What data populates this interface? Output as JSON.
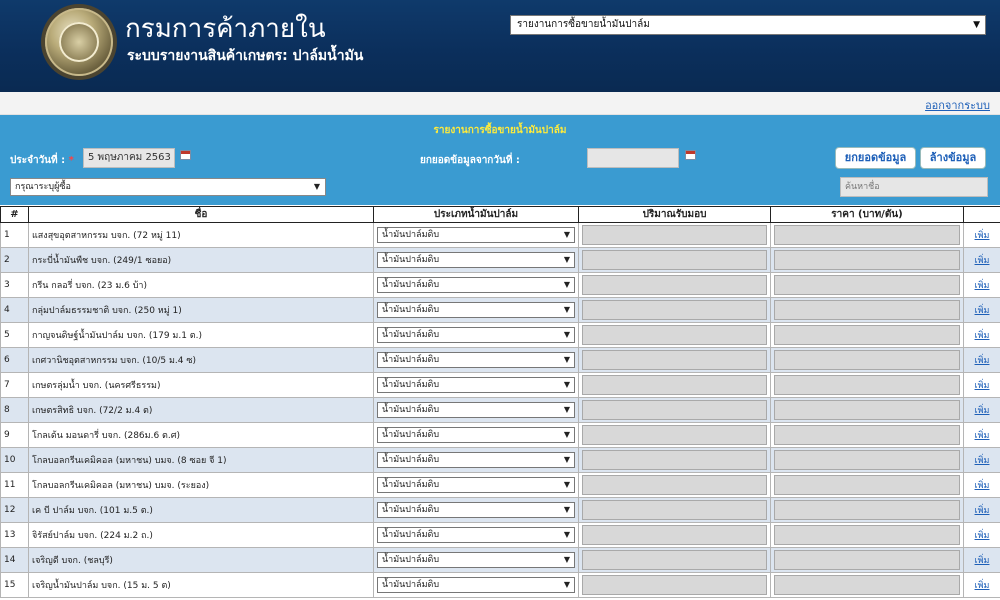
{
  "header": {
    "title": "กรมการค้าภายใน",
    "subtitle": "ระบบรายงานสินค้าเกษตร: ปาล์มน้ำมัน",
    "report_select": "รายงานการซื้อขายน้ำมันปาล์ม",
    "dropdown_icon": "triangle-down-icon"
  },
  "topbar": {
    "logout": "ออกจากระบบ"
  },
  "form": {
    "section_title": "รายงานการซื้อขายน้ำมันปาล์ม",
    "date_label": "ประจำวันที่ :",
    "required_mark": "*",
    "date_value": "5 พฤษภาคม 2563",
    "carry_label": "ยกยอดข้อมูลจากวันที่ :",
    "carry_value": "",
    "carry_button": "ยกยอดข้อมูล",
    "clear_button": "ล้างข้อมูล",
    "buyer_select": "กรุณาระบุผู้ซื้อ",
    "search_placeholder": "ค้นหาชื่อ"
  },
  "table": {
    "headers": [
      "#",
      "ชื่อ",
      "ประเภทน้ำมันปาล์ม",
      "ปริมาณรับมอบ",
      "ราคา (บาท/ตัน)",
      ""
    ],
    "rows": [
      {
        "no": "1",
        "name": "แสงสุขอุตสาหกรรม บจก. (72 หมู่ 11)",
        "type": "น้ำมันปาล์มดิบ",
        "action": "เพิ่ม"
      },
      {
        "no": "2",
        "name": "กระบี่น้ำมันพืช บจก. (249/1 ซอยอ)",
        "type": "น้ำมันปาล์มดิบ",
        "action": "เพิ่ม"
      },
      {
        "no": "3",
        "name": "กรีน กลอรี่ บจก. (23 ม.6 บ้า)",
        "type": "น้ำมันปาล์มดิบ",
        "action": "เพิ่ม"
      },
      {
        "no": "4",
        "name": "กลุ่มปาล์มธรรมชาติ บจก. (250 หมู่ 1)",
        "type": "น้ำมันปาล์มดิบ",
        "action": "เพิ่ม"
      },
      {
        "no": "5",
        "name": "กาญจนดิษฐ์น้ำมันปาล์ม บจก. (179 ม.1 ต.)",
        "type": "น้ำมันปาล์มดิบ",
        "action": "เพิ่ม"
      },
      {
        "no": "6",
        "name": "เกศวานิชอุตสาหกรรม บจก. (10/5 ม.4 ซ)",
        "type": "น้ำมันปาล์มดิบ",
        "action": "เพิ่ม"
      },
      {
        "no": "7",
        "name": "เกษตรลุ่มน้ำ บจก. (นครศรีธรรม)",
        "type": "น้ำมันปาล์มดิบ",
        "action": "เพิ่ม"
      },
      {
        "no": "8",
        "name": "เกษตรสิทธิ บจก. (72/2 ม.4 ต)",
        "type": "น้ำมันปาล์มดิบ",
        "action": "เพิ่ม"
      },
      {
        "no": "9",
        "name": "โกลเด้น มอนดารี่ บจก. (286ม.6 ต.ศ)",
        "type": "น้ำมันปาล์มดิบ",
        "action": "เพิ่ม"
      },
      {
        "no": "10",
        "name": "โกลบอลกรีนเคมิคอล (มหาชน) บมจ. (8 ซอย จี 1)",
        "type": "น้ำมันปาล์มดิบ",
        "action": "เพิ่ม"
      },
      {
        "no": "11",
        "name": "โกลบอลกรีนเคมิคอล (มหาชน) บมจ. (ระยอง)",
        "type": "น้ำมันปาล์มดิบ",
        "action": "เพิ่ม"
      },
      {
        "no": "12",
        "name": "เค บี ปาล์ม บจก. (101 ม.5 ต.)",
        "type": "น้ำมันปาล์มดิบ",
        "action": "เพิ่ม"
      },
      {
        "no": "13",
        "name": "จิรัสย์ปาล์ม บจก. (224 ม.2 ถ.)",
        "type": "น้ำมันปาล์มดิบ",
        "action": "เพิ่ม"
      },
      {
        "no": "14",
        "name": "เจริญดี บจก. (ชลบุรี)",
        "type": "น้ำมันปาล์มดิบ",
        "action": "เพิ่ม"
      },
      {
        "no": "15",
        "name": "เจริญน้ำมันปาล์ม บจก. (15 ม. 5 ต)",
        "type": "น้ำมันปาล์มดิบ",
        "action": "เพิ่ม"
      }
    ]
  }
}
